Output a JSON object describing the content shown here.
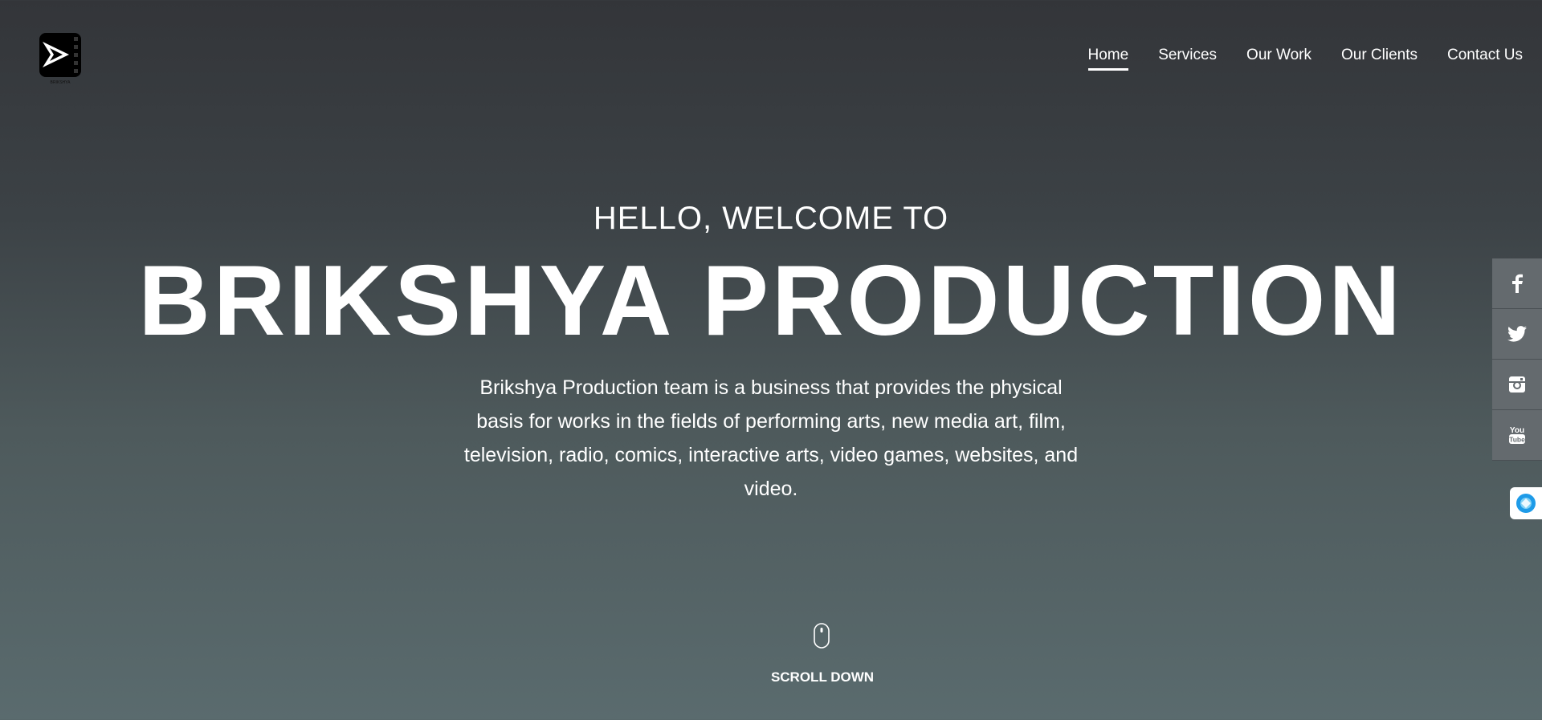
{
  "logo": {
    "icon": "film-play-logo",
    "caption": "BRIKSHYA"
  },
  "nav": {
    "items": [
      {
        "label": "Home",
        "active": true
      },
      {
        "label": "Services"
      },
      {
        "label": "Our Work"
      },
      {
        "label": "Our Clients"
      },
      {
        "label": "Contact Us"
      }
    ]
  },
  "hero": {
    "subtitle": "HELLO, WELCOME TO",
    "title": "BRIKSHYA PRODUCTION",
    "description": "Brikshya Production team is a business that provides the physical basis for works in the fields of performing arts, new media art, film, television, radio, comics, interactive arts, video games, websites, and video."
  },
  "social": {
    "items": [
      {
        "icon": "facebook-icon"
      },
      {
        "icon": "twitter-icon"
      },
      {
        "icon": "instagram-icon"
      },
      {
        "icon": "youtube-icon"
      }
    ]
  },
  "chat": {
    "icon": "chat-widget-icon"
  },
  "scroll": {
    "label": "SCROLL DOWN",
    "icon": "mouse-icon"
  }
}
